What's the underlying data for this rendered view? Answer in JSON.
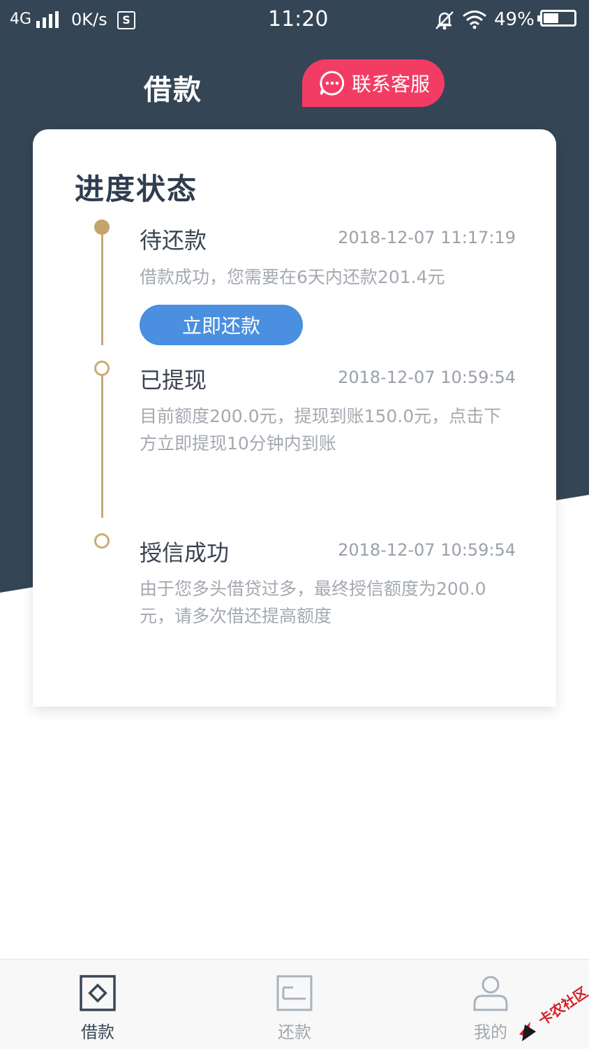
{
  "status_bar": {
    "network": "4G",
    "speed": "0K/s",
    "sim_badge": "S",
    "time": "11:20",
    "battery": "49%"
  },
  "header": {
    "title": "借款",
    "service_label": "联系客服"
  },
  "card": {
    "title": "进度状态",
    "steps": [
      {
        "title": "待还款",
        "time": "2018-12-07 11:17:19",
        "desc": "借款成功，您需要在6天内还款201.4元",
        "action": "立即还款"
      },
      {
        "title": "已提现",
        "time": "2018-12-07 10:59:54",
        "desc": "目前额度200.0元，提现到账150.0元，点击下方立即提现10分钟内到账"
      },
      {
        "title": "授信成功",
        "time": "2018-12-07 10:59:54",
        "desc": "由于您多头借贷过多，最终授信额度为200.0元，请多次借还提高额度"
      }
    ]
  },
  "tabbar": {
    "items": [
      {
        "label": "借款",
        "icon": "diamond-square-icon",
        "active": true
      },
      {
        "label": "还款",
        "icon": "bill-icon",
        "active": false
      },
      {
        "label": "我的",
        "icon": "user-icon",
        "active": false
      }
    ]
  },
  "watermark": {
    "text": "卡农社区"
  },
  "colors": {
    "header_bg": "#344555",
    "accent_pink": "#f23c64",
    "timeline_gold": "#c6a977",
    "button_blue": "#4a8fe0"
  }
}
